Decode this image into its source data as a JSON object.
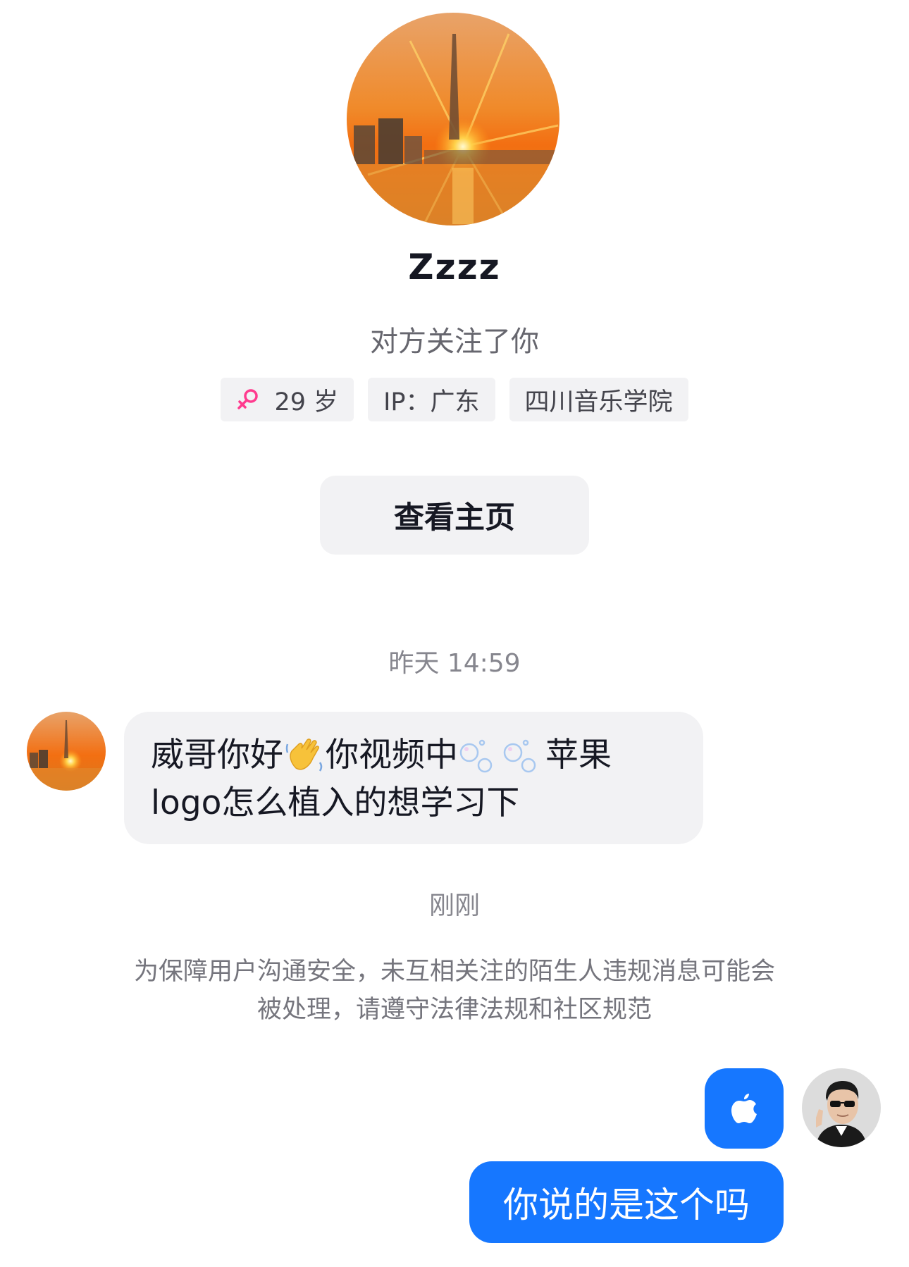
{
  "profile": {
    "name": "Zzzz",
    "follow_status": "对方关注了你",
    "avatar_icon": "sunset-cityscape-avatar",
    "tags": {
      "age": "29 岁",
      "gender_icon": "female-icon",
      "gender_color": "#ff3b8e",
      "ip": "IP：广东",
      "school": "四川音乐学院"
    },
    "view_profile_label": "查看主页"
  },
  "chat": {
    "timestamp_1": "昨天 14:59",
    "incoming_message": {
      "part_1": "威哥你好",
      "emoji_1": "👋",
      "part_2": "你视频中",
      "emoji_2": "🫧🫧",
      "part_3": "苹果",
      "line_2": "logo怎么植入的想学习下"
    },
    "timestamp_2": "刚刚",
    "safety_notice_line_1": "为保障用户沟通安全，未互相关注的陌生人违规消息可能会",
    "safety_notice_line_2": "被处理，请遵守法律法规和社区规范",
    "outgoing_sticker_icon": "apple-logo-icon",
    "outgoing_message": "你说的是这个吗",
    "accent_color": "#1677ff"
  }
}
